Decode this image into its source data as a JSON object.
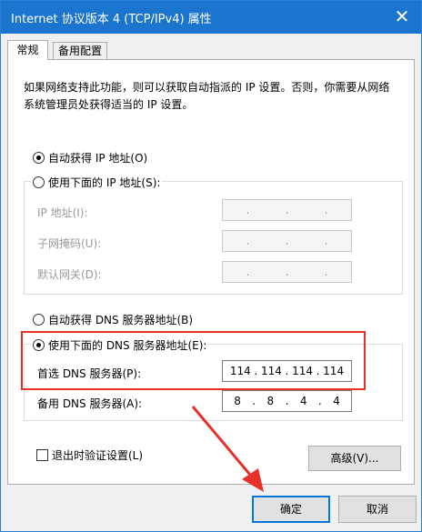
{
  "window": {
    "title": "Internet 协议版本 4 (TCP/IPv4) 属性",
    "close_glyph": "✕"
  },
  "tabs": [
    {
      "label": "常规"
    },
    {
      "label": "备用配置"
    }
  ],
  "description": "如果网络支持此功能，则可以获取自动指派的 IP 设置。否则，你需要从网络系统管理员处获得适当的 IP 设置。",
  "ip_section": {
    "auto_label": "自动获得 IP 地址(O)",
    "auto_selected": true,
    "manual_label": "使用下面的 IP 地址(S):",
    "manual_selected": false,
    "fields": [
      {
        "label": "IP 地址(I):",
        "value": [
          ".",
          ".",
          "."
        ]
      },
      {
        "label": "子网掩码(U):",
        "value": [
          ".",
          ".",
          "."
        ]
      },
      {
        "label": "默认网关(D):",
        "value": [
          ".",
          ".",
          "."
        ]
      }
    ]
  },
  "dns_section": {
    "auto_label": "自动获得 DNS 服务器地址(B)",
    "auto_selected": false,
    "manual_label": "使用下面的 DNS 服务器地址(E):",
    "manual_selected": true,
    "preferred": {
      "label": "首选 DNS 服务器(P):",
      "octets": [
        "114",
        ".",
        "114",
        ".",
        "114",
        ".",
        "114"
      ]
    },
    "alternate": {
      "label": "备用 DNS 服务器(A):",
      "octets": [
        "8",
        ".",
        "8",
        ".",
        "4",
        ".",
        "4"
      ]
    }
  },
  "validate_on_exit": {
    "label": "退出时验证设置(L)",
    "checked": false
  },
  "buttons": {
    "advanced": "高级(V)...",
    "ok": "确定",
    "cancel": "取消"
  },
  "annotation_colors": {
    "highlight": "#e6302a"
  }
}
